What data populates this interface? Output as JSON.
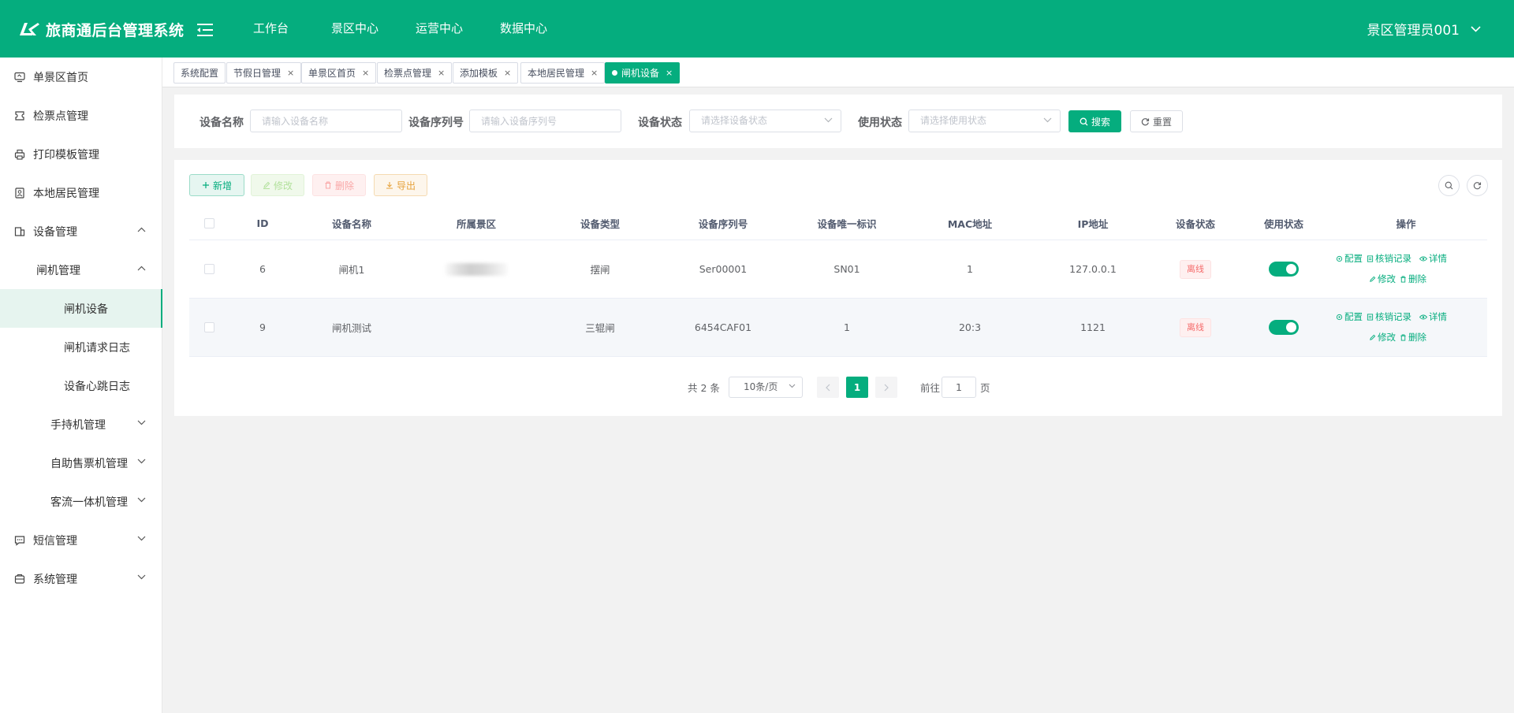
{
  "app": {
    "title": "旅商通后台管理系统"
  },
  "topnav": [
    "工作台",
    "景区中心",
    "运营中心",
    "数据中心"
  ],
  "user": {
    "name": "景区管理员001"
  },
  "sidebar": {
    "items": [
      {
        "label": "单景区首页",
        "icon": "monitor-icon"
      },
      {
        "label": "检票点管理",
        "icon": "ticket-icon"
      },
      {
        "label": "打印模板管理",
        "icon": "print-icon"
      },
      {
        "label": "本地居民管理",
        "icon": "resident-icon"
      },
      {
        "label": "设备管理",
        "icon": "device-icon"
      },
      {
        "label": "闸机管理"
      },
      {
        "label": "闸机设备"
      },
      {
        "label": "闸机请求日志"
      },
      {
        "label": "设备心跳日志"
      },
      {
        "label": "手持机管理"
      },
      {
        "label": "自助售票机管理"
      },
      {
        "label": "客流一体机管理"
      },
      {
        "label": "短信管理",
        "icon": "message-icon"
      },
      {
        "label": "系统管理",
        "icon": "system-icon"
      }
    ]
  },
  "tags": [
    {
      "label": "系统配置"
    },
    {
      "label": "节假日管理",
      "close": "×"
    },
    {
      "label": "单景区首页",
      "close": "×"
    },
    {
      "label": "检票点管理",
      "close": "×"
    },
    {
      "label": "添加模板",
      "close": "×"
    },
    {
      "label": "本地居民管理",
      "close": "×"
    },
    {
      "label": "闸机设备",
      "close": "×"
    }
  ],
  "search": {
    "device_name_label": "设备名称",
    "device_name_placeholder": "请输入设备名称",
    "serial_label": "设备序列号",
    "serial_placeholder": "请输入设备序列号",
    "status_label": "设备状态",
    "status_placeholder": "请选择设备状态",
    "use_label": "使用状态",
    "use_placeholder": "请选择使用状态",
    "search_btn": "搜索",
    "reset_btn": "重置"
  },
  "toolbar": {
    "add": "新增",
    "edit": "修改",
    "delete": "删除",
    "export": "导出"
  },
  "table": {
    "headers": [
      "ID",
      "设备名称",
      "所属景区",
      "设备类型",
      "设备序列号",
      "设备唯一标识",
      "MAC地址",
      "IP地址",
      "设备状态",
      "使用状态",
      "操作"
    ],
    "rows": [
      {
        "id": "6",
        "name": "闸机1",
        "scenic": "",
        "type": "摆闸",
        "serial": "Ser00001",
        "uid": "SN01",
        "mac": "1",
        "ip": "127.0.0.1",
        "status": "离线",
        "enabled": true
      },
      {
        "id": "9",
        "name": "闸机测试",
        "scenic": "",
        "type": "三辊闸",
        "serial": "6454CAF01",
        "uid": "1",
        "mac": "20:3",
        "ip": "1121",
        "status": "离线",
        "enabled": true
      }
    ],
    "ops": {
      "config": "配置",
      "records": "核销记录",
      "detail": "详情",
      "edit": "修改",
      "delete": "删除"
    }
  },
  "pagination": {
    "total": "共 2 条",
    "page_size": "10条/页",
    "current": "1",
    "goto": "前往",
    "jump_value": "1",
    "unit": "页"
  },
  "colors": {
    "primary": "#05ad7e",
    "offline": "#f56c6c"
  }
}
